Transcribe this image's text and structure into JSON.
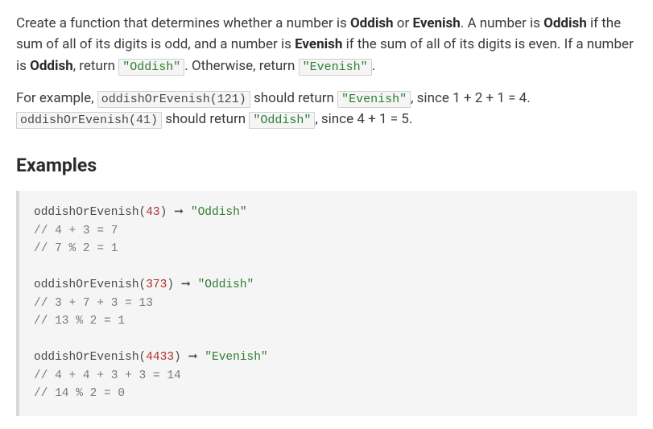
{
  "intro": {
    "p1_a": "Create a function that determines whether a number is ",
    "p1_b": " or ",
    "p1_c": ". A number is ",
    "p1_d": " if the sum of all of its digits is odd, and a number is ",
    "p1_e": " if the sum of all of its digits is even. If a number is ",
    "p1_f": ", return ",
    "p1_g": ". Otherwise, return ",
    "p1_h": ".",
    "oddish": "Oddish",
    "evenish": "Evenish",
    "code_oddish": "\"Oddish\"",
    "code_evenish": "\"Evenish\""
  },
  "ex_intro": {
    "a": "For example, ",
    "call1": "oddishOrEvenish(121)",
    "b": " should return ",
    "ret1": "\"Evenish\"",
    "c": ", since 1 + 2 + 1 = 4. ",
    "call2": "oddishOrEvenish(41)",
    "d": " should return ",
    "ret2": "\"Oddish\"",
    "e": ", since 4 + 1 = 5."
  },
  "heading": "Examples",
  "code": {
    "l1_call": "oddishOrEvenish(",
    "l1_arg": "43",
    "l1_close": ") ",
    "l1_arrow": "➞",
    "l1_ret": " \"Oddish\"",
    "l2": "// 4 + 3 = 7",
    "l3": "// 7 % 2 = 1",
    "blank1": "",
    "l4_call": "oddishOrEvenish(",
    "l4_arg": "373",
    "l4_close": ") ",
    "l4_arrow": "➞",
    "l4_ret": " \"Oddish\"",
    "l5": "// 3 + 7 + 3 = 13",
    "l6": "// 13 % 2 = 1",
    "blank2": "",
    "l7_call": "oddishOrEvenish(",
    "l7_arg": "4433",
    "l7_close": ") ",
    "l7_arrow": "➞",
    "l7_ret": " \"Evenish\"",
    "l8": "// 4 + 4 + 3 + 3 = 14",
    "l9": "// 14 % 2 = 0"
  }
}
